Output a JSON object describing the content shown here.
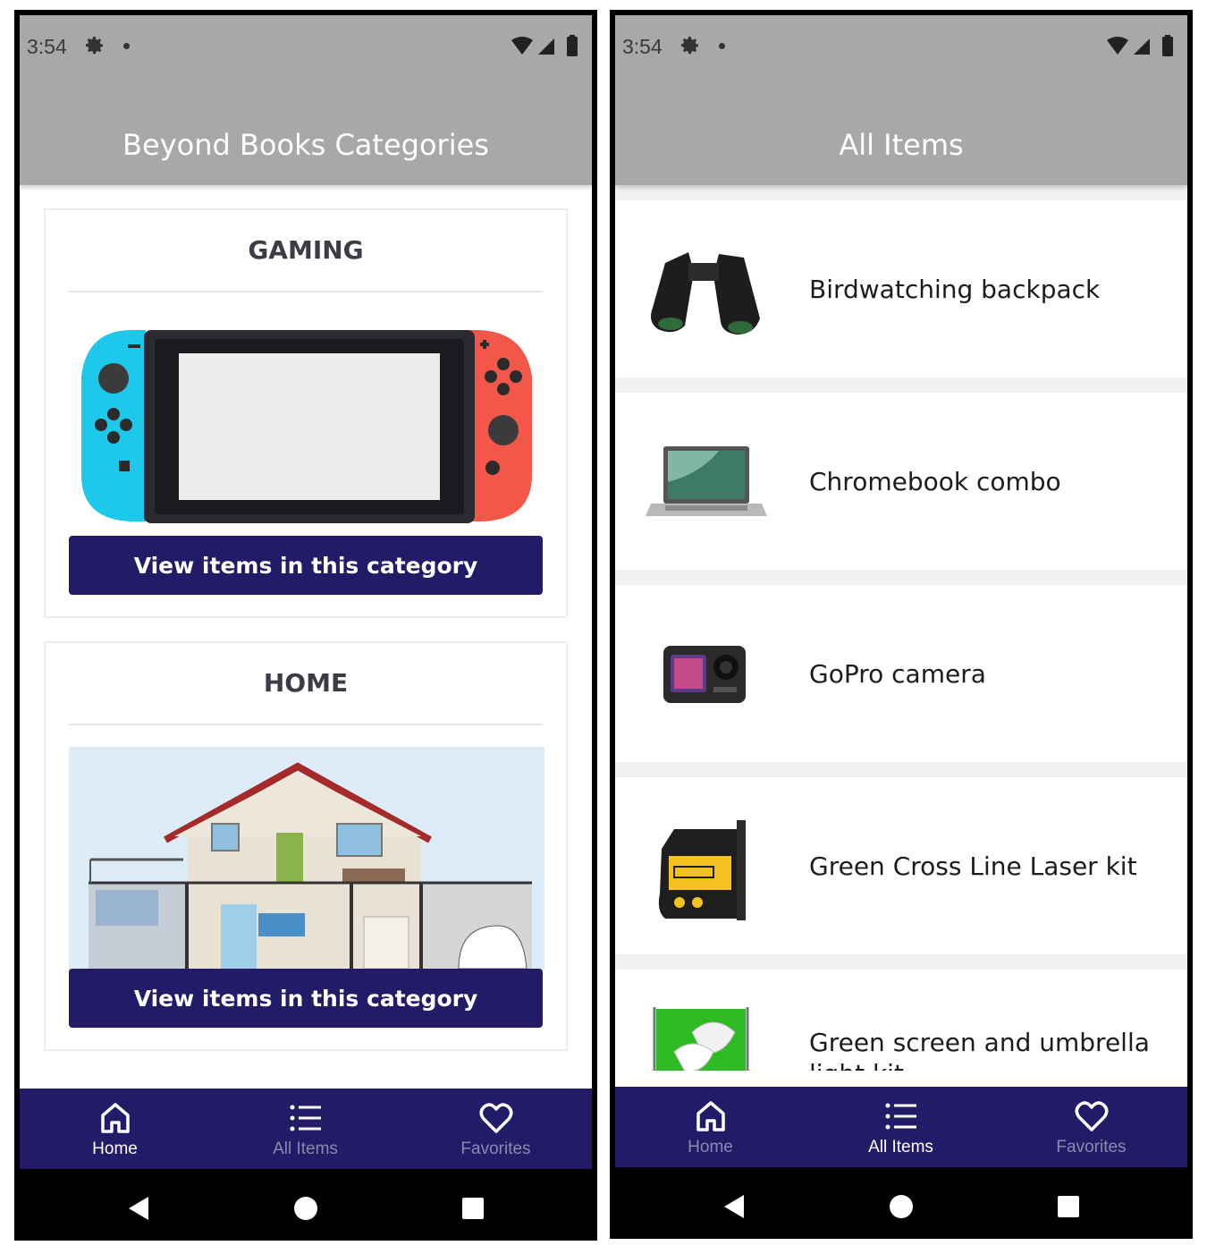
{
  "left_screen": {
    "status": {
      "time": "3:54"
    },
    "header": {
      "title": "Beyond Books Categories"
    },
    "categories": [
      {
        "title": "GAMING",
        "button_label": "View items in this category",
        "image_icon": "game-console-illustration"
      },
      {
        "title": "HOME",
        "button_label": "View items in this category",
        "image_icon": "house-cutaway-illustration"
      }
    ],
    "bottom_nav": {
      "items": [
        {
          "label": "Home",
          "icon": "home-icon",
          "active": true
        },
        {
          "label": "All Items",
          "icon": "list-icon",
          "active": false
        },
        {
          "label": "Favorites",
          "icon": "heart-icon",
          "active": false
        }
      ]
    }
  },
  "right_screen": {
    "status": {
      "time": "3:54"
    },
    "header": {
      "title": "All Items"
    },
    "items": [
      {
        "name": "Birdwatching backpack",
        "image_icon": "binoculars-image"
      },
      {
        "name": "Chromebook combo",
        "image_icon": "laptop-image"
      },
      {
        "name": "GoPro camera",
        "image_icon": "action-camera-image"
      },
      {
        "name": "Green Cross Line Laser kit",
        "image_icon": "laser-level-image"
      },
      {
        "name": "Green screen and umbrella light kit",
        "image_icon": "green-screen-image"
      }
    ],
    "bottom_nav": {
      "items": [
        {
          "label": "Home",
          "icon": "home-icon",
          "active": false
        },
        {
          "label": "All Items",
          "icon": "list-icon",
          "active": true
        },
        {
          "label": "Favorites",
          "icon": "heart-icon",
          "active": false
        }
      ]
    }
  },
  "colors": {
    "header_bg": "#a8a8a8",
    "nav_bg": "#241b68",
    "button_bg": "#241b68",
    "nav_inactive": "#8c88ae"
  }
}
